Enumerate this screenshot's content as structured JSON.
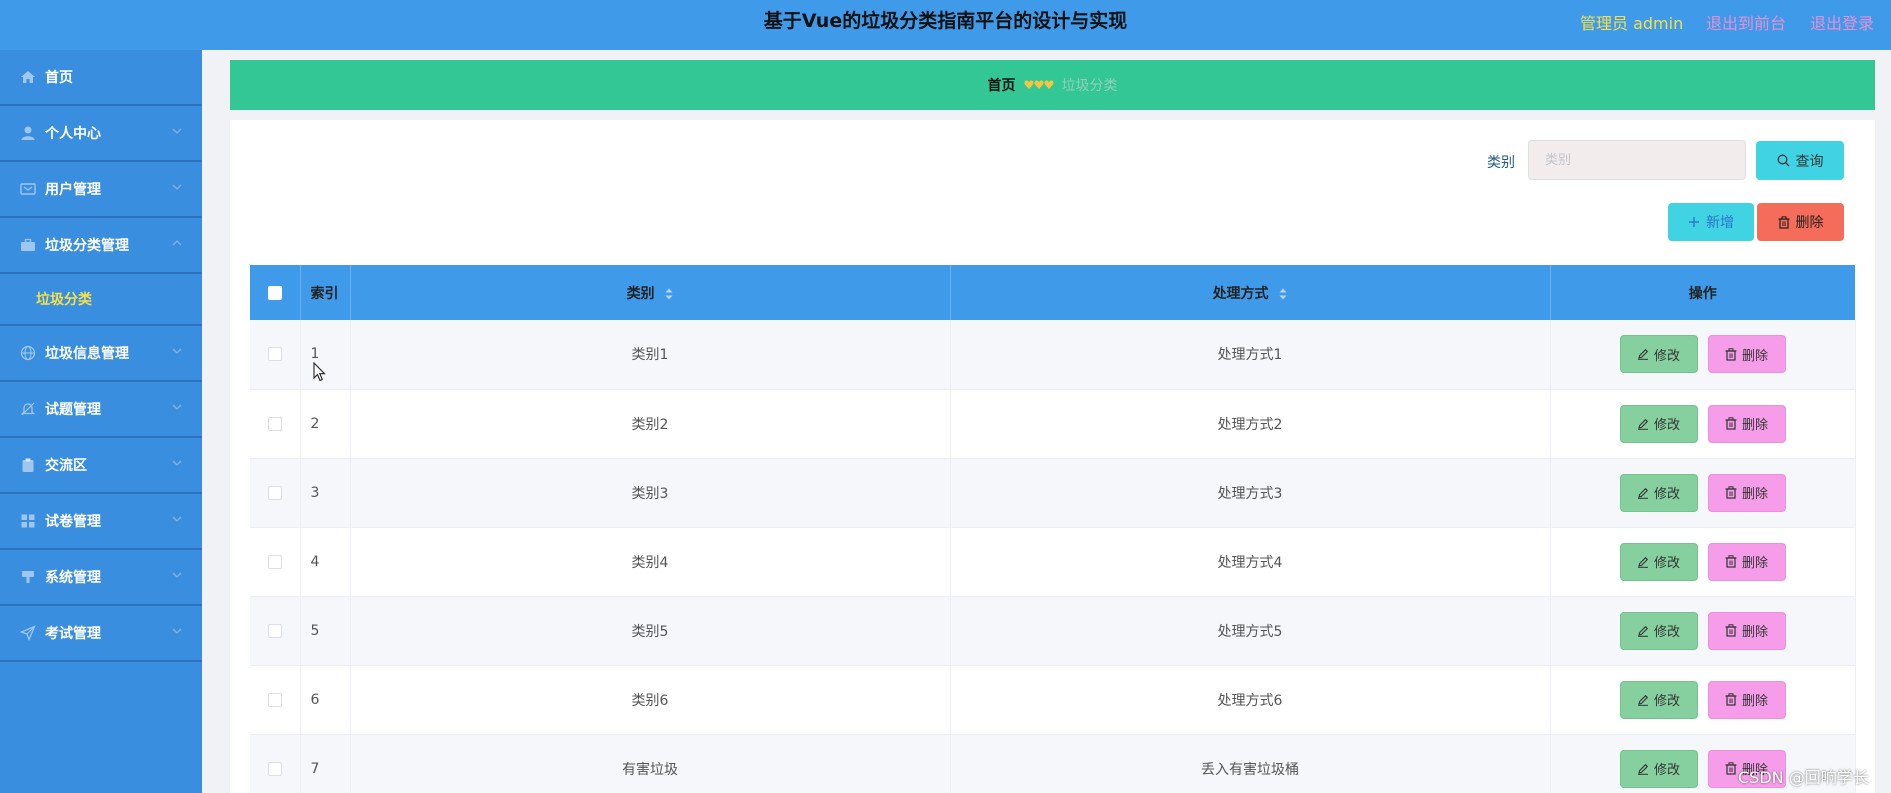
{
  "header": {
    "title": "基于Vue的垃圾分类指南平台的设计与实现",
    "admin_label": "管理员 admin",
    "back_label": "退出到前台",
    "logout_label": "退出登录"
  },
  "sidebar": {
    "items": [
      {
        "label": "首页",
        "icon": "home-icon"
      },
      {
        "label": "个人中心",
        "icon": "user-icon"
      },
      {
        "label": "用户管理",
        "icon": "id-card-icon"
      },
      {
        "label": "垃圾分类管理",
        "icon": "briefcase-icon"
      },
      {
        "label": "垃圾信息管理",
        "icon": "globe-icon"
      },
      {
        "label": "试题管理",
        "icon": "bell-icon"
      },
      {
        "label": "交流区",
        "icon": "clipboard-icon"
      },
      {
        "label": "试卷管理",
        "icon": "grid-icon"
      },
      {
        "label": "系统管理",
        "icon": "brush-icon"
      },
      {
        "label": "考试管理",
        "icon": "send-icon"
      }
    ],
    "submenu_label": "垃圾分类"
  },
  "breadcrumb": {
    "home": "首页",
    "current": "垃圾分类"
  },
  "search": {
    "label": "类别",
    "placeholder": "类别",
    "query_label": "查询"
  },
  "toolbar": {
    "add_label": "新增",
    "delete_label": "删除"
  },
  "table": {
    "headers": {
      "index": "索引",
      "category": "类别",
      "method": "处理方式",
      "actions": "操作"
    },
    "edit_label": "修改",
    "delete_label": "删除",
    "rows": [
      {
        "index": "1",
        "category": "类别1",
        "method": "处理方式1"
      },
      {
        "index": "2",
        "category": "类别2",
        "method": "处理方式2"
      },
      {
        "index": "3",
        "category": "类别3",
        "method": "处理方式3"
      },
      {
        "index": "4",
        "category": "类别4",
        "method": "处理方式4"
      },
      {
        "index": "5",
        "category": "类别5",
        "method": "处理方式5"
      },
      {
        "index": "6",
        "category": "类别6",
        "method": "处理方式6"
      },
      {
        "index": "7",
        "category": "有害垃圾",
        "method": "丢入有害垃圾桶"
      }
    ]
  },
  "watermark": "CSDN @回响学长",
  "colors": {
    "topbar": "#3f9bea",
    "sidebar": "#3a8ee0",
    "breadcrumb": "#33c795",
    "accent_cyan": "#3fd3e3",
    "danger": "#f56c5a",
    "edit_green": "#86d0a0",
    "delete_pink": "#f59de8"
  }
}
